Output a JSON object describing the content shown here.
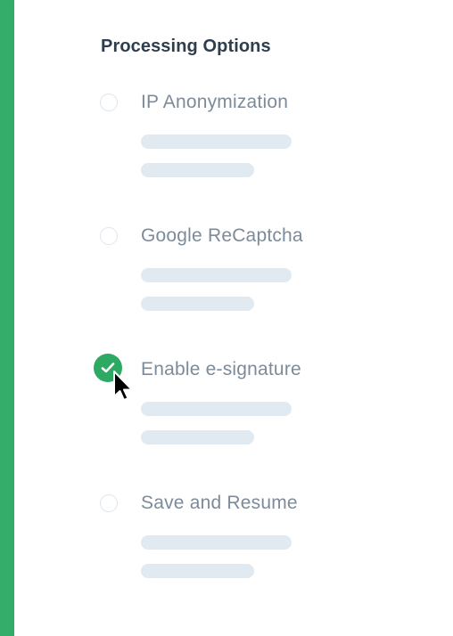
{
  "section": {
    "title": "Processing Options"
  },
  "options": [
    {
      "label": "IP Anonymization",
      "checked": false
    },
    {
      "label": "Google ReCaptcha",
      "checked": false
    },
    {
      "label": "Enable e-signature",
      "checked": true
    },
    {
      "label": "Save and Resume",
      "checked": false
    }
  ],
  "colors": {
    "accent": "#34ad6b",
    "checked": "#2da964",
    "title": "#2e3e4e",
    "label": "#7d8b99",
    "skeleton": "#e1e9f1"
  },
  "icons": {
    "check": "checkmark-icon",
    "cursor": "mouse-pointer-icon"
  }
}
